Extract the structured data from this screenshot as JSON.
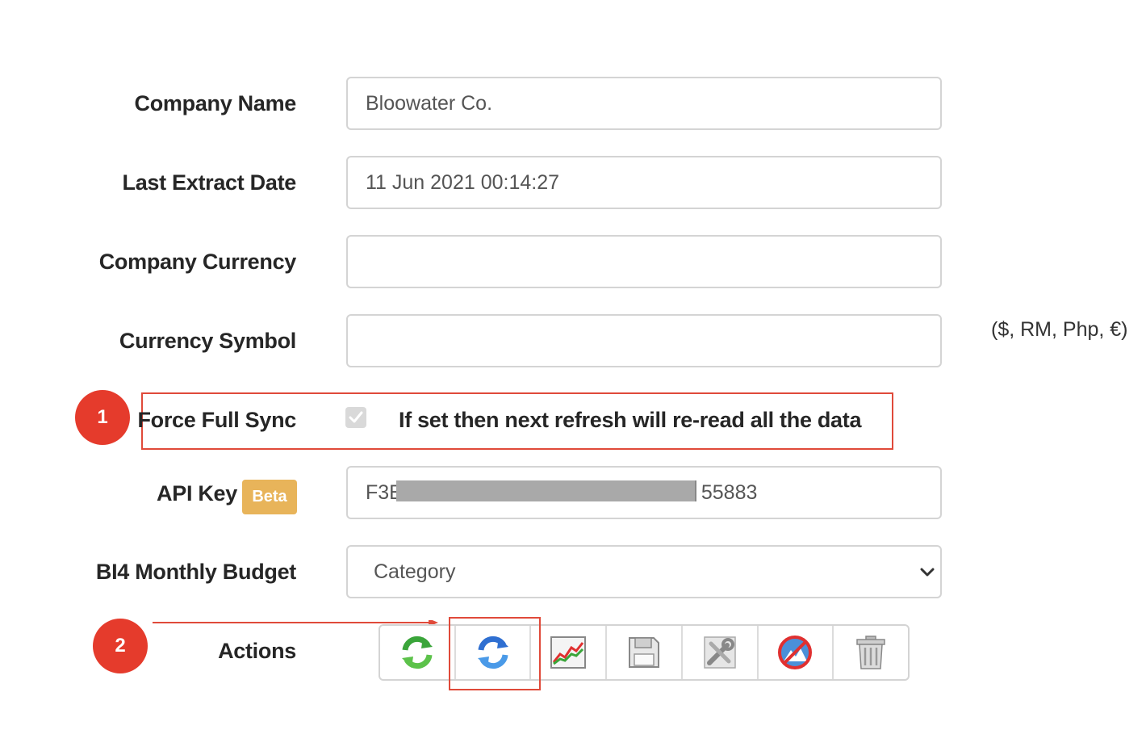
{
  "form": {
    "company_name": {
      "label": "Company Name",
      "value": "Bloowater Co."
    },
    "last_extract_date": {
      "label": "Last Extract Date",
      "value": "11 Jun 2021 00:14:27"
    },
    "company_currency": {
      "label": "Company Currency",
      "value": ""
    },
    "currency_symbol": {
      "label": "Currency Symbol",
      "value": "",
      "hint": "($, RM, Php, €)"
    },
    "force_full_sync": {
      "label": "Force Full Sync",
      "checked": true,
      "description": "If set then next refresh will re-read all the data"
    },
    "api_key": {
      "label": "API Key",
      "badge": "Beta",
      "value_prefix": "F3E",
      "value_suffix": "55883"
    },
    "monthly_budget": {
      "label": "BI4 Monthly Budget",
      "selected": "Category"
    },
    "actions": {
      "label": "Actions",
      "buttons": [
        {
          "name": "refresh-green-icon"
        },
        {
          "name": "refresh-blue-icon"
        },
        {
          "name": "chart-icon"
        },
        {
          "name": "save-icon"
        },
        {
          "name": "tools-icon"
        },
        {
          "name": "disable-icon"
        },
        {
          "name": "trash-icon"
        }
      ]
    }
  },
  "callouts": {
    "one": "1",
    "two": "2"
  },
  "colors": {
    "callout_red": "#e53b2c",
    "beta_badge": "#e8b45a",
    "border": "#d4d4d4"
  }
}
